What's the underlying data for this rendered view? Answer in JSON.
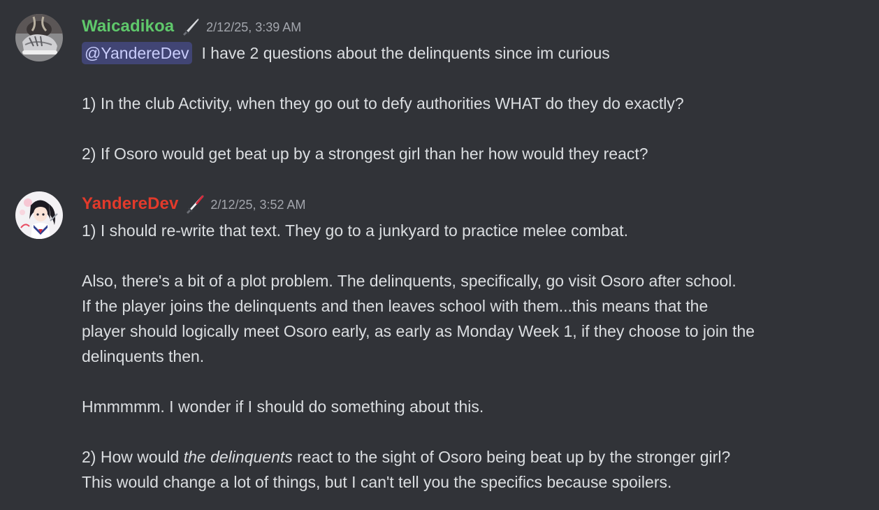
{
  "messages": [
    {
      "author": {
        "name": "Waicadikoa",
        "color": "#5fc86b",
        "role_icon": "knife-icon"
      },
      "timestamp": "2/12/25, 3:39 AM",
      "mention": "@YandereDev",
      "lines": [
        "I have 2 questions about the delinquents since im curious",
        "",
        "1) In the club Activity, when they go out to defy authorities WHAT do they do exactly?",
        "",
        "2) If Osoro would get beat up by a strongest girl than her how would they react?"
      ]
    },
    {
      "author": {
        "name": "YandereDev",
        "color": "#e23a2b",
        "role_icon": "bloody-knife-icon"
      },
      "timestamp": "2/12/25, 3:52 AM",
      "lines": [
        "1) I should re-write that text. They go to a junkyard to practice melee combat.",
        "",
        "Also, there's a bit of a plot problem. The delinquents, specifically, go visit Osoro after school.",
        "If the player joins the delinquents and then leaves school with them...this means that the",
        "player should logically meet Osoro early, as early as Monday Week 1, if they choose to join the",
        "delinquents then.",
        "",
        "Hmmmmm. I wonder if I should do something about this.",
        "",
        "2) How would",
        "the delinquents",
        "react to the sight of Osoro being beat up by the stronger girl?",
        "This would change a lot of things, but I can't tell you the specifics because spoilers."
      ]
    }
  ]
}
